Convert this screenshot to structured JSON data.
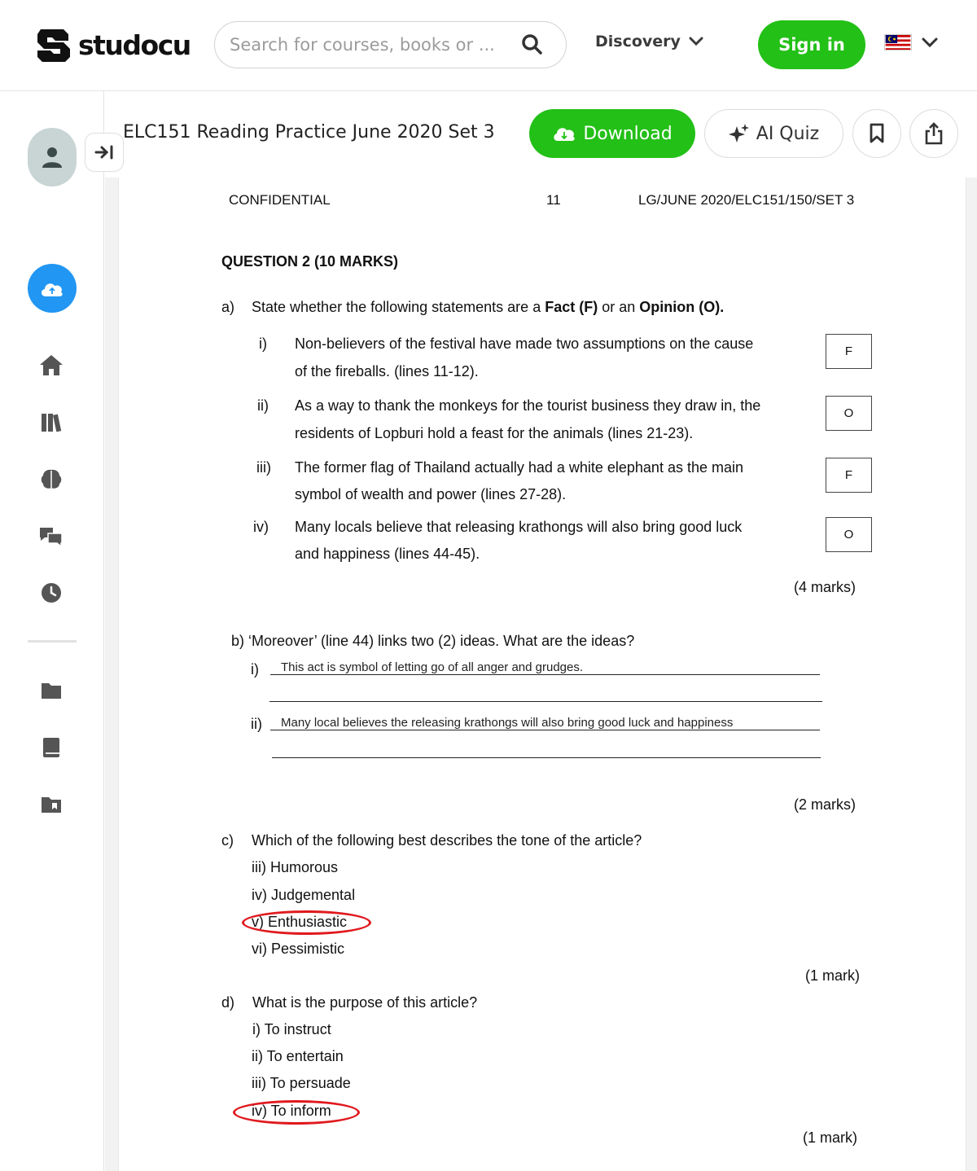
{
  "header": {
    "logo_text": "studocu",
    "search_placeholder": "Search for courses, books or ...",
    "discovery_label": "Discovery",
    "signin_label": "Sign in"
  },
  "toolbar": {
    "doc_title": "ELC151 Reading Practice June 2020 Set 3",
    "download_label": "Download",
    "ai_quiz_label": "AI Quiz"
  },
  "sidebar": {
    "icons": [
      "user-icon",
      "collapse-icon",
      "upload-icon",
      "home-icon",
      "library-icon",
      "brain-icon",
      "chat-icon",
      "history-icon",
      "folder-icon",
      "book-icon",
      "bookmark-folder-icon"
    ]
  },
  "colors": {
    "brand_green": "#23c017",
    "upload_blue": "#2196f3",
    "annotation_red": "#e0191e"
  },
  "document": {
    "head_left": "CONFIDENTIAL",
    "head_center": "11",
    "head_right": "LG/JUNE 2020/ELC151/150/SET 3",
    "q2_title": "QUESTION 2 (10 MARKS)",
    "a": {
      "letter": "a)",
      "prompt_pre": "State whether the following statements are a ",
      "prompt_fact": "Fact (F)",
      "prompt_mid": " or an ",
      "prompt_opinion": "Opinion (O).",
      "items": [
        {
          "num": "i)",
          "line1": "Non-believers of the festival have made two assumptions on the cause",
          "line2": "of the fireballs. (lines 11-12).",
          "answer": "F"
        },
        {
          "num": "ii)",
          "line1": "As a way to thank the monkeys for the tourist business they draw in, the",
          "line2": "residents of Lopburi hold a feast for the animals (lines 21-23).",
          "answer": "O"
        },
        {
          "num": "iii)",
          "line1": "The former flag of Thailand actually had a white elephant as the main",
          "line2": "symbol of wealth and power (lines 27-28).",
          "answer": "F"
        },
        {
          "num": "iv)",
          "line1": "Many locals believe that releasing krathongs will also bring good luck",
          "line2": "and happiness (lines 44-45).",
          "answer": "O"
        }
      ],
      "marks": "(4 marks)"
    },
    "b": {
      "prompt": "b)  ‘Moreover’ (line 44) links two (2) ideas. What are the ideas?",
      "i_num": "i)",
      "i_answer": "This act is symbol of letting go of all anger and grudges.",
      "ii_num": "ii)",
      "ii_answer": "Many local believes the releasing krathongs will also bring good luck and happiness",
      "marks": "(2 marks)"
    },
    "c": {
      "letter": "c)",
      "prompt": "Which of the following best describes the tone of the article?",
      "options": [
        "iii) Humorous",
        "iv) Judgemental",
        "v) Enthusiastic",
        "vi) Pessimistic"
      ],
      "selected": "v) Enthusiastic",
      "marks": "(1 mark)"
    },
    "d": {
      "letter": "d)",
      "prompt": "What is the purpose of this article?",
      "options": [
        "i)  To instruct",
        "ii) To entertain",
        "iii) To persuade",
        "iv) To inform"
      ],
      "selected": "iv) To inform",
      "marks": "(1 mark)"
    }
  }
}
